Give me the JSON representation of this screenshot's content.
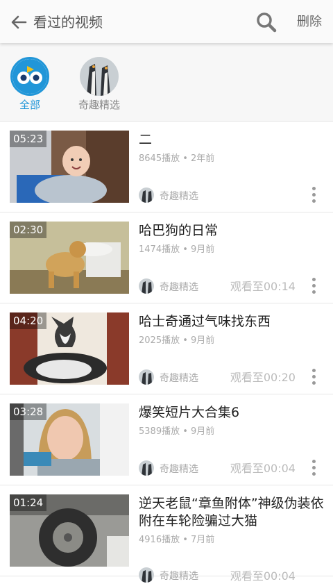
{
  "header": {
    "back_icon": "arrow-left-icon",
    "title": "看过的视频",
    "search_icon": "search-icon",
    "delete_label": "删除"
  },
  "filters": [
    {
      "label": "全部",
      "selected": true,
      "icon": "owl-logo-icon",
      "accent": "#2196d8"
    },
    {
      "label": "奇趣精选",
      "selected": false,
      "icon": "penguins-avatar"
    }
  ],
  "videos": [
    {
      "duration": "05:23",
      "title": "二",
      "plays": "8645播放",
      "age": "2年前",
      "channel": "奇趣精选",
      "watched": ""
    },
    {
      "duration": "02:30",
      "title": "哈巴狗的日常",
      "plays": "1474播放",
      "age": "9月前",
      "channel": "奇趣精选",
      "watched": "观看至00:14"
    },
    {
      "duration": "04:20",
      "title": "哈士奇通过气味找东西",
      "plays": "2025播放",
      "age": "9月前",
      "channel": "奇趣精选",
      "watched": "观看至00:20"
    },
    {
      "duration": "03:28",
      "title": "爆笑短片大合集6",
      "plays": "5389播放",
      "age": "9月前",
      "channel": "奇趣精选",
      "watched": "观看至00:04"
    },
    {
      "duration": "01:24",
      "title": "逆天老鼠“章鱼附体”神级伪装依附在车轮险骗过大猫",
      "plays": "4916播放",
      "age": "7月前",
      "channel": "奇趣精选",
      "watched": "观看至00:04"
    }
  ],
  "meta_separator": " • "
}
